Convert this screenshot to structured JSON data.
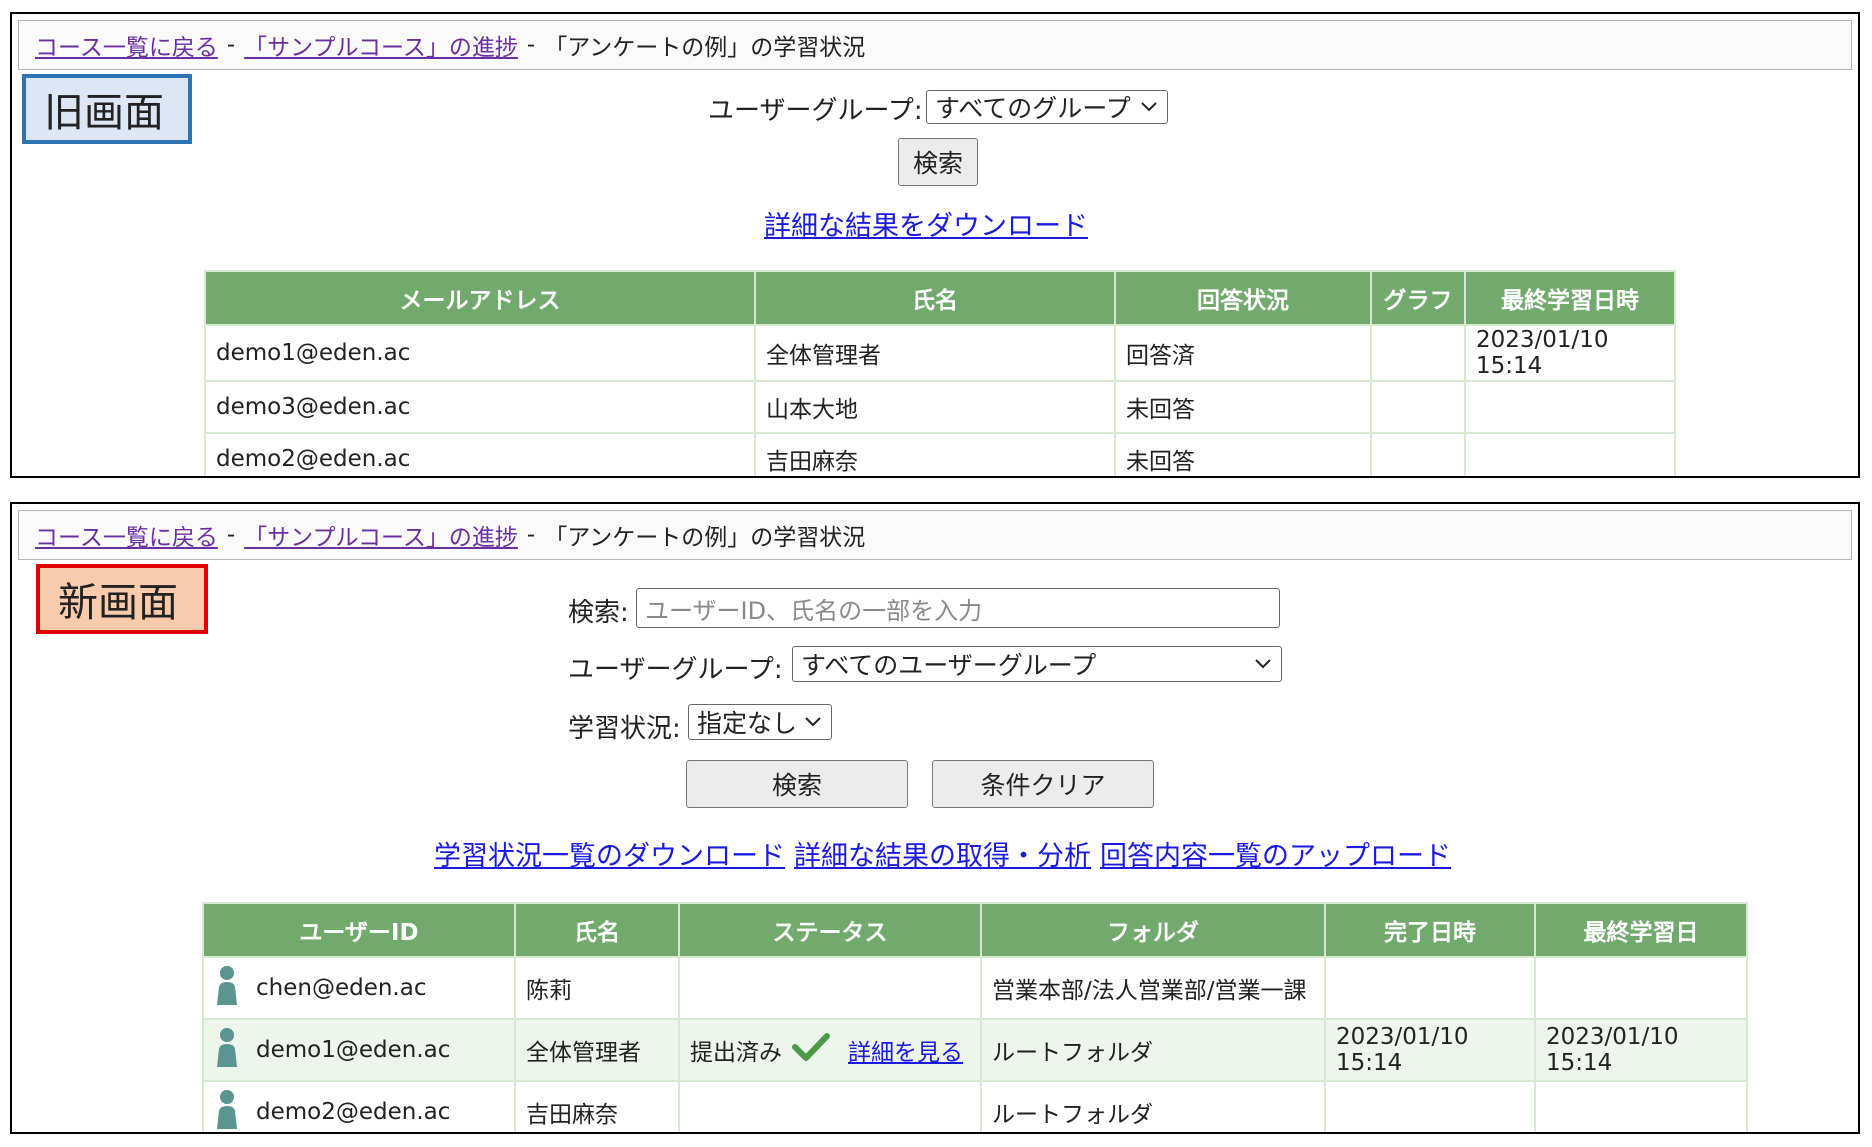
{
  "old_screen": {
    "breadcrumb": {
      "back_link": "コース一覧に戻る",
      "sep1": "-",
      "progress_link": "「サンプルコース」の進捗",
      "sep2": "-",
      "current": "「アンケートの例」の学習状況"
    },
    "badge": "旧画面",
    "filters": {
      "group_label": "ユーザーグループ:",
      "group_value": "すべてのグループ"
    },
    "search_button": "検索",
    "download_link": "詳細な結果をダウンロード",
    "table": {
      "headers": [
        "メールアドレス",
        "氏名",
        "回答状況",
        "グラフ",
        "最終学習日時"
      ],
      "rows": [
        [
          "demo1@eden.ac",
          "全体管理者",
          "回答済",
          "",
          "2023/01/10 15:14"
        ],
        [
          "demo3@eden.ac",
          "山本大地",
          "未回答",
          "",
          ""
        ],
        [
          "demo2@eden.ac",
          "吉田麻奈",
          "未回答",
          "",
          ""
        ]
      ]
    }
  },
  "new_screen": {
    "breadcrumb": {
      "back_link": "コース一覧に戻る",
      "sep1": "-",
      "progress_link": "「サンプルコース」の進捗",
      "sep2": "-",
      "current": "「アンケートの例」の学習状況"
    },
    "badge": "新画面",
    "filters": {
      "search_label": "検索:",
      "search_placeholder": "ユーザーID、氏名の一部を入力",
      "group_label": "ユーザーグループ:",
      "group_value": "すべてのユーザーグループ",
      "status_label": "学習状況:",
      "status_value": "指定なし"
    },
    "buttons": {
      "search": "検索",
      "clear": "条件クリア"
    },
    "links": [
      "学習状況一覧のダウンロード",
      "詳細な結果の取得・分析",
      "回答内容一覧のアップロード"
    ],
    "table": {
      "headers": [
        "ユーザーID",
        "氏名",
        "ステータス",
        "フォルダ",
        "完了日時",
        "最終学習日"
      ],
      "rows": [
        {
          "user_id": "chen@eden.ac",
          "name": "陈莉",
          "status": "",
          "detail_link": "",
          "folder": "営業本部/法人営業部/営業一課",
          "completed": "",
          "last": ""
        },
        {
          "user_id": "demo1@eden.ac",
          "name": "全体管理者",
          "status": "提出済み",
          "detail_link": "詳細を見る",
          "folder": "ルートフォルダ",
          "completed": "2023/01/10 15:14",
          "last": "2023/01/10 15:14"
        },
        {
          "user_id": "demo2@eden.ac",
          "name": "吉田麻奈",
          "status": "",
          "detail_link": "",
          "folder": "ルートフォルダ",
          "completed": "",
          "last": ""
        }
      ]
    }
  },
  "colors": {
    "header_green": "#72aa6e",
    "old_badge_border": "#2e74b5",
    "new_badge_border": "#e00000",
    "link_blue": "#1a1ae0",
    "check_green": "#4d9a4a",
    "user_icon": "#5a9590"
  }
}
